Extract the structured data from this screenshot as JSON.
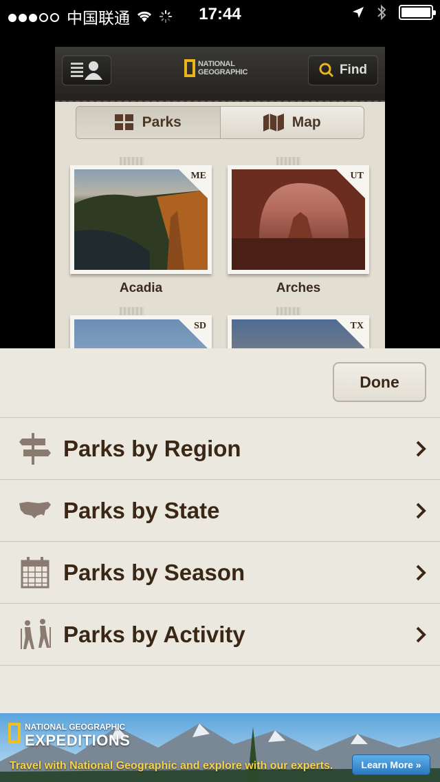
{
  "status_bar": {
    "carrier": "中国联通",
    "time": "17:44"
  },
  "app": {
    "find_label": "Find",
    "logo_text": [
      "NATIONAL",
      "GEOGRAPHIC"
    ],
    "segments": [
      {
        "label": "Parks",
        "icon": "grid-icon",
        "active": true
      },
      {
        "label": "Map",
        "icon": "map-icon",
        "active": false
      }
    ],
    "parks": [
      {
        "name": "Acadia",
        "state": "ME"
      },
      {
        "name": "Arches",
        "state": "UT"
      },
      {
        "name": "",
        "state": "SD"
      },
      {
        "name": "",
        "state": "TX"
      }
    ]
  },
  "sheet": {
    "done_label": "Done",
    "options": [
      {
        "label": "Parks by Region",
        "icon": "signpost-icon"
      },
      {
        "label": "Parks by State",
        "icon": "usa-map-icon"
      },
      {
        "label": "Parks by Season",
        "icon": "calendar-icon"
      },
      {
        "label": "Parks by Activity",
        "icon": "hikers-icon"
      }
    ]
  },
  "ad": {
    "brand": [
      "NATIONAL GEOGRAPHIC"
    ],
    "title": "EXPEDITIONS",
    "tagline": "Travel with National Geographic and explore with our experts.",
    "button": "Learn More »"
  },
  "colors": {
    "accent_yellow": "#e8b61a",
    "text_brown": "#3a2716",
    "sheet_bg": "#ebe8df"
  }
}
